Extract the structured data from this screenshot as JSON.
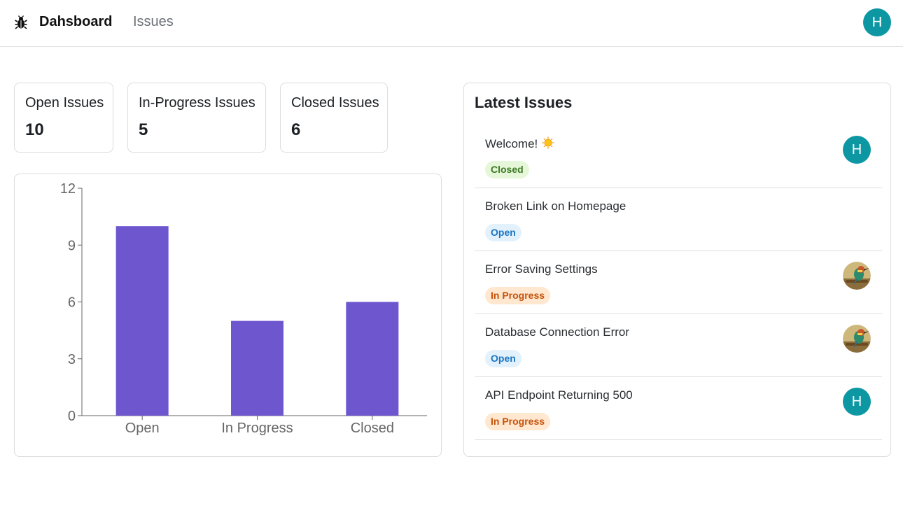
{
  "nav": {
    "brand": "Dahsboard",
    "issues_link": "Issues",
    "user_initial": "H"
  },
  "stats": [
    {
      "label": "Open Issues",
      "value": "10"
    },
    {
      "label": "In-Progress Issues",
      "value": "5"
    },
    {
      "label": "Closed Issues",
      "value": "6"
    }
  ],
  "chart_data": {
    "type": "bar",
    "categories": [
      "Open",
      "In Progress",
      "Closed"
    ],
    "values": [
      10,
      5,
      6
    ],
    "ylim": [
      0,
      12
    ],
    "yticks": [
      0,
      3,
      6,
      9,
      12
    ],
    "title": "",
    "xlabel": "",
    "ylabel": "",
    "bar_color": "#6e56cf",
    "grid": false
  },
  "latest": {
    "title": "Latest Issues",
    "issues": [
      {
        "title": "Welcome!",
        "icon": "sun-emoji-icon",
        "status": "Closed",
        "assignee": "H"
      },
      {
        "title": "Broken Link on Homepage",
        "status": "Open",
        "assignee": ""
      },
      {
        "title": "Error Saving Settings",
        "status": "In Progress",
        "assignee": "bird-photo"
      },
      {
        "title": "Database Connection Error",
        "status": "Open",
        "assignee": "bird-photo"
      },
      {
        "title": "API Endpoint Returning 500",
        "status": "In Progress",
        "assignee": "H"
      }
    ]
  },
  "colors": {
    "accent": "#0d97a3",
    "bar": "#6e56cf",
    "closed_badge_bg": "#e6f6d8",
    "open_badge_bg": "#e3f1fd",
    "progress_badge_bg": "#ffe8cf"
  }
}
